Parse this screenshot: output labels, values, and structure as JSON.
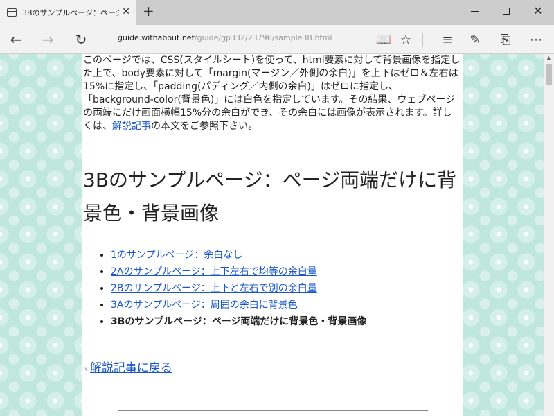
{
  "tab": {
    "title": "3Bのサンプルページ：ページ",
    "close": "✕",
    "new_tab": "+"
  },
  "window": {
    "minimize": "",
    "maximize": "",
    "close": "✕"
  },
  "nav": {
    "back": "←",
    "forward": "→",
    "refresh": "↻",
    "address_host": "guide.withabout.net",
    "address_path": "/guide/gp332/23796/sample3B.html"
  },
  "toolbar": {
    "reading_view": "📖",
    "favorite": "☆",
    "hub": "≡",
    "web_note": "✎",
    "share": "⎘",
    "more": "⋯"
  },
  "page": {
    "intro_before_link": "このページでは、CSS(スタイルシート)を使って、html要素に対して背景画像を指定した上で、body要素に対して「margin(マージン／外側の余白)」を上下はゼロ＆左右は15%に指定し、「padding(パディング／内側の余白)」はゼロに指定し、「background-color(背景色)」には白色を指定しています。その結果、ウェブページの両端にだけ画面横幅15%分の余白ができ、その余白には画像が表示されます。詳しくは、",
    "intro_link": "解説記事",
    "intro_after_link": "の本文をご参照下さい。",
    "heading": "3Bのサンプルページ：ページ両端だけに背景色・背景画像",
    "links": [
      "1のサンプルページ：余白なし",
      "2Aのサンプルページ：上下左右で均等の余白量",
      "2Bのサンプルページ：上下と左右で別の余白量",
      "3Aのサンプルページ：周囲の余白に背景色"
    ],
    "current": "3Bのサンプルページ：ページ両端だけに背景色・背景画像",
    "back_icon": "☜",
    "back_link": "解説記事に戻る"
  },
  "colors": {
    "pattern_bg": "#bfe7de",
    "link": "#1a56c8",
    "chrome": "#f2f2f2"
  }
}
